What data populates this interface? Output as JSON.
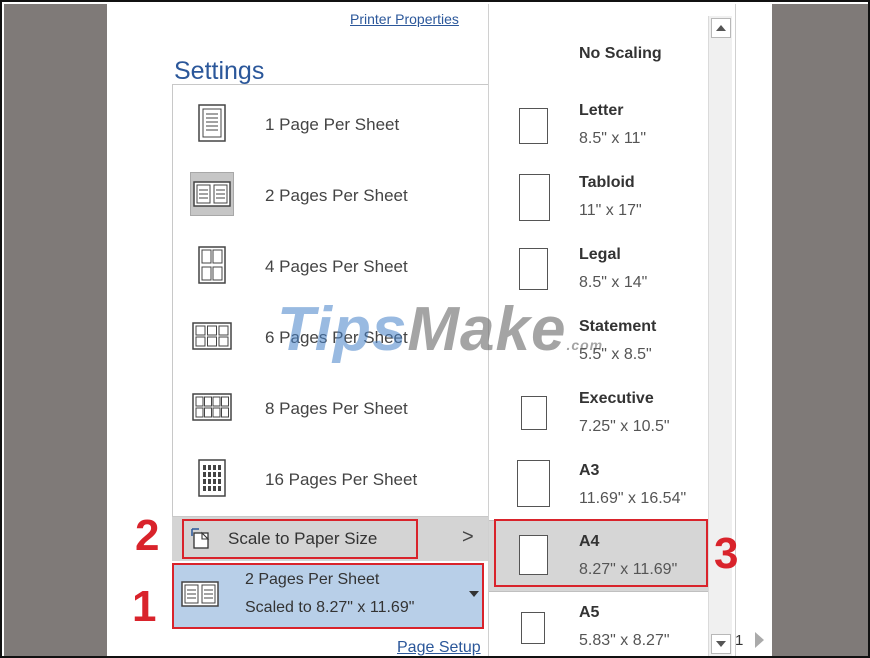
{
  "header": {
    "printer_properties": "Printer Properties",
    "settings_title": "Settings"
  },
  "pages_menu": {
    "items": [
      {
        "label": "1 Page Per Sheet",
        "icon": "one-page-icon"
      },
      {
        "label": "2 Pages Per Sheet",
        "icon": "two-pages-icon",
        "selected": true
      },
      {
        "label": "4 Pages Per Sheet",
        "icon": "four-pages-icon"
      },
      {
        "label": "6 Pages Per Sheet",
        "icon": "six-pages-icon"
      },
      {
        "label": "8 Pages Per Sheet",
        "icon": "eight-pages-icon"
      },
      {
        "label": "16 Pages Per Sheet",
        "icon": "sixteen-pages-icon"
      }
    ],
    "scale_item": {
      "label": "Scale to Paper Size",
      "icon": "scale-page-icon",
      "chevron": ">"
    }
  },
  "selector": {
    "line1": "2 Pages Per Sheet",
    "line2": "Scaled to 8.27\" x 11.69\""
  },
  "footer": {
    "page_setup": "Page Setup",
    "page_number": "1"
  },
  "paper_sizes": [
    {
      "name": "No Scaling",
      "dim": ""
    },
    {
      "name": "Letter",
      "dim": "8.5\" x 11\""
    },
    {
      "name": "Tabloid",
      "dim": "11\" x 17\""
    },
    {
      "name": "Legal",
      "dim": "8.5\" x 14\""
    },
    {
      "name": "Statement",
      "dim": "5.5\" x 8.5\""
    },
    {
      "name": "Executive",
      "dim": "7.25\" x 10.5\""
    },
    {
      "name": "A3",
      "dim": "11.69\" x 16.54\""
    },
    {
      "name": "A4",
      "dim": "8.27\" x 11.69\"",
      "selected": true
    },
    {
      "name": "A5",
      "dim": "5.83\" x 8.27\""
    }
  ],
  "callouts": {
    "one": "1",
    "two": "2",
    "three": "3"
  },
  "watermark": {
    "part1": "Tips",
    "part2": "Make",
    "part3": ".com"
  },
  "colors": {
    "accent": "#2b579a",
    "callout": "#d9232b",
    "selector_bg": "#b8cfe8"
  }
}
